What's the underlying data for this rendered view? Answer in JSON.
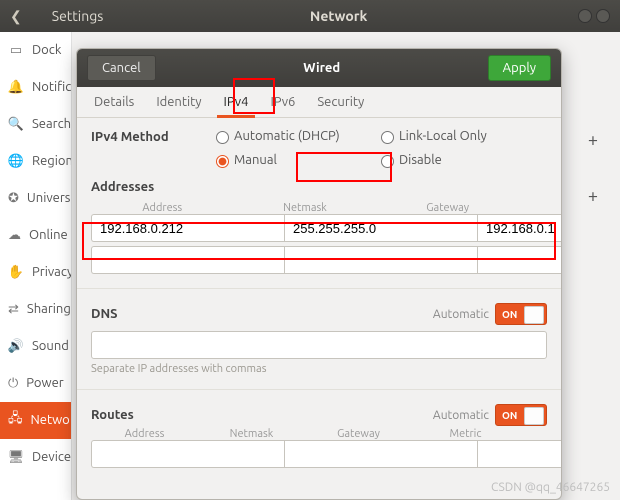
{
  "settings": {
    "title": "Settings",
    "panel": "Network",
    "sidebar": [
      {
        "icon": "dock",
        "label": "Dock"
      },
      {
        "icon": "bell",
        "label": "Notific"
      },
      {
        "icon": "search",
        "label": "Search"
      },
      {
        "icon": "globe",
        "label": "Region"
      },
      {
        "icon": "access",
        "label": "Univers"
      },
      {
        "icon": "cloud",
        "label": "Online"
      },
      {
        "icon": "hand",
        "label": "Privacy"
      },
      {
        "icon": "share",
        "label": "Sharing"
      },
      {
        "icon": "sound",
        "label": "Sound"
      },
      {
        "icon": "power",
        "label": "Power"
      },
      {
        "icon": "network",
        "label": "Netwo"
      },
      {
        "icon": "devices",
        "label": "Devices"
      }
    ],
    "active_index": 10
  },
  "dialog": {
    "cancel": "Cancel",
    "title": "Wired",
    "apply": "Apply",
    "tabs": [
      "Details",
      "Identity",
      "IPv4",
      "IPv6",
      "Security"
    ],
    "active_tab": 2,
    "ipv4": {
      "method_label": "IPv4 Method",
      "options": {
        "auto": "Automatic (DHCP)",
        "linklocal": "Link-Local Only",
        "manual": "Manual",
        "disable": "Disable"
      },
      "selected": "manual",
      "addresses_label": "Addresses",
      "addr_headers": {
        "a": "Address",
        "n": "Netmask",
        "g": "Gateway"
      },
      "rows": [
        {
          "address": "192.168.0.212",
          "netmask": "255.255.255.0",
          "gateway": "192.168.0.1"
        }
      ],
      "dns_label": "DNS",
      "automatic_label": "Automatic",
      "on_label": "ON",
      "dns_hint": "Separate IP addresses with commas",
      "routes_label": "Routes",
      "routes_headers": {
        "a": "Address",
        "n": "Netmask",
        "g": "Gateway",
        "m": "Metric"
      }
    }
  },
  "watermark": "CSDN @qq_46647265"
}
